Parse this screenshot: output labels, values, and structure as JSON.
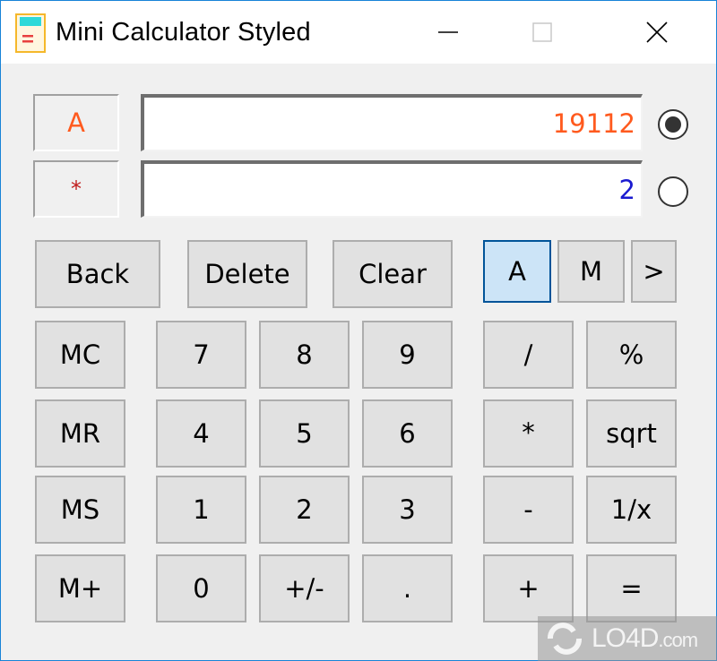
{
  "window": {
    "title": "Mini Calculator Styled",
    "icon": "calculator-app-icon",
    "controls": {
      "minimize": "minimize-icon",
      "maximize": "maximize-icon",
      "close": "close-icon"
    }
  },
  "registers": {
    "a": {
      "label": "A",
      "value": "19112",
      "selected": true,
      "color": "#ff5a1e"
    },
    "b": {
      "label": "*",
      "value": "2",
      "selected": false,
      "color": "#1a1ad0",
      "label_color": "#c01a1a"
    }
  },
  "edit_buttons": [
    "Back",
    "Delete",
    "Clear"
  ],
  "mode_buttons": [
    {
      "label": "A",
      "active": true
    },
    {
      "label": "M",
      "active": false
    },
    {
      "label": ">",
      "active": false
    }
  ],
  "memory_buttons": [
    "MC",
    "MR",
    "MS",
    "M+"
  ],
  "digit_rows": [
    [
      "7",
      "8",
      "9"
    ],
    [
      "4",
      "5",
      "6"
    ],
    [
      "1",
      "2",
      "3"
    ],
    [
      "0",
      "+/-",
      "."
    ]
  ],
  "operator_rows": [
    [
      "/",
      "%"
    ],
    [
      "*",
      "sqrt"
    ],
    [
      "-",
      "1/x"
    ],
    [
      "+",
      "="
    ]
  ],
  "watermark": {
    "main": "LO4D",
    "suffix": ".com"
  },
  "colors": {
    "active_border": "#005499",
    "active_fill": "#cce4f7",
    "window_border": "#1883d7"
  }
}
